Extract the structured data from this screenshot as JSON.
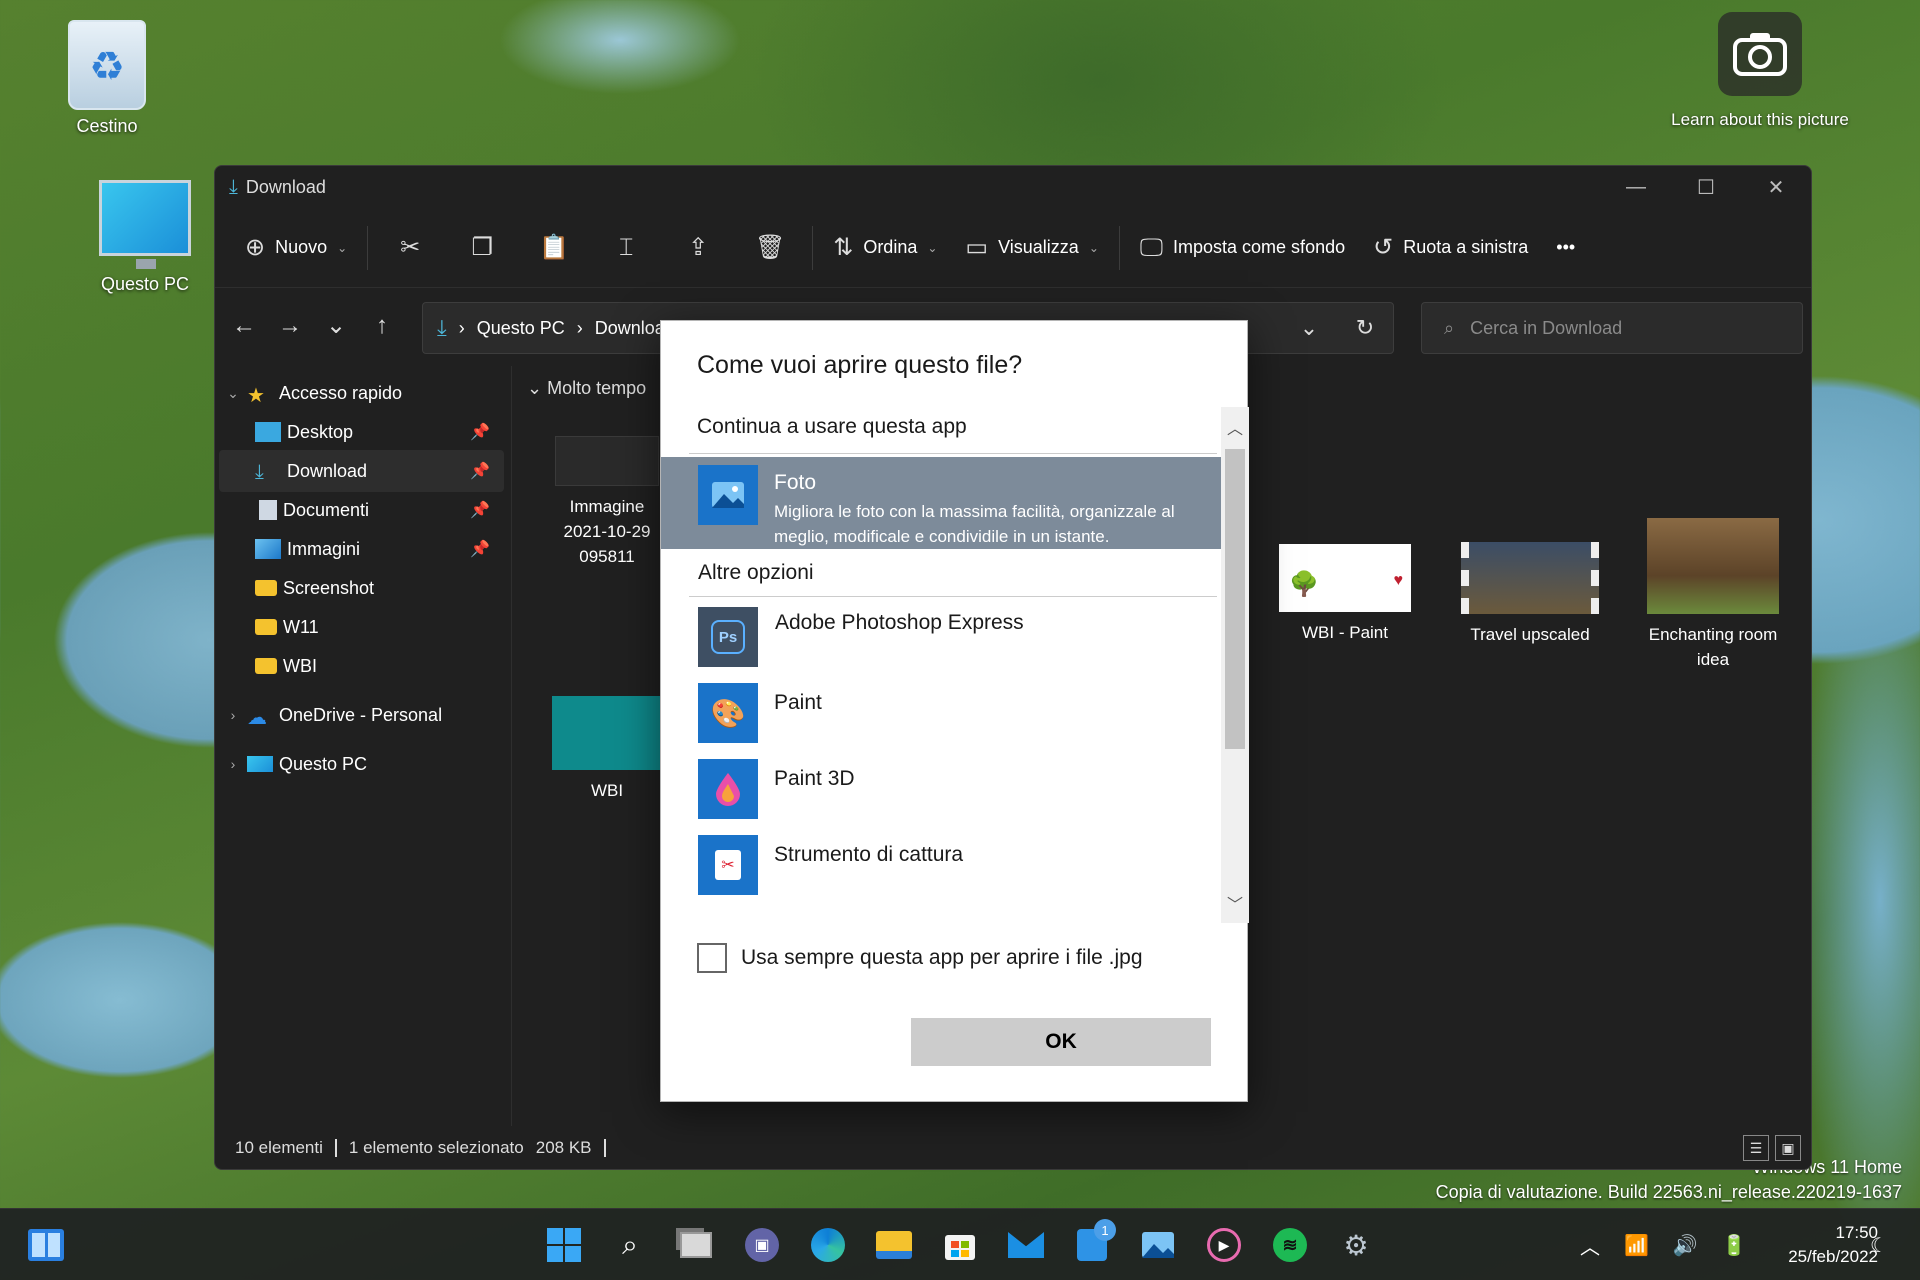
{
  "desktop": {
    "recycle_bin_label": "Cestino",
    "this_pc_label": "Questo PC",
    "learn_label": "Learn about this picture",
    "watermark_line1": "Windows 11 Home",
    "watermark_line2": "Copia di valutazione. Build 22563.ni_release.220219-1637"
  },
  "explorer": {
    "title": "Download",
    "toolbar": {
      "new_label": "Nuovo",
      "sort_label": "Ordina",
      "view_label": "Visualizza",
      "set_background_label": "Imposta come sfondo",
      "rotate_left_label": "Ruota a sinistra",
      "more_label": "•••"
    },
    "address": {
      "crumb1": "Questo PC",
      "crumb2": "Download",
      "search_placeholder": "Cerca in Download"
    },
    "sidebar": {
      "quick_access": "Accesso rapido",
      "items": [
        {
          "label": "Desktop"
        },
        {
          "label": "Download"
        },
        {
          "label": "Documenti"
        },
        {
          "label": "Immagini"
        },
        {
          "label": "Screenshot"
        },
        {
          "label": "W11"
        },
        {
          "label": "WBI"
        }
      ],
      "onedrive": "OneDrive - Personal",
      "this_pc": "Questo PC"
    },
    "content": {
      "group_label": "Molto tempo",
      "files": [
        {
          "label_line1": "Immagine",
          "label_line2": "2021-10-29",
          "label_line3": "095811"
        },
        {
          "label": "WBI"
        },
        {
          "label": "WBI - Paint"
        },
        {
          "label": "Travel upscaled"
        },
        {
          "label_line1": "Enchanting room",
          "label_line2": "idea"
        }
      ]
    },
    "status": {
      "count": "10 elementi",
      "selected": "1 elemento selezionato",
      "size": "208 KB"
    }
  },
  "dialog": {
    "title": "Come vuoi aprire questo file?",
    "keep_using": "Continua a usare questa app",
    "selected_app": {
      "name": "Foto",
      "description": "Migliora le foto con la massima facilità, organizzale al meglio, modificale e condividile in un istante."
    },
    "other_options": "Altre opzioni",
    "apps": [
      {
        "name": "Adobe Photoshop Express"
      },
      {
        "name": "Paint"
      },
      {
        "name": "Paint 3D"
      },
      {
        "name": "Strumento di cattura"
      }
    ],
    "always_use_label": "Usa sempre questa app per aprire i file .jpg",
    "always_use_checked": false,
    "ok_label": "OK"
  },
  "taskbar": {
    "time": "17:50",
    "date": "25/feb/2022",
    "teams_badge": "1"
  },
  "colors": {
    "accent": "#4db6d8",
    "dialog_selected": "#7d8b9a",
    "folder": "#f4c22e"
  }
}
